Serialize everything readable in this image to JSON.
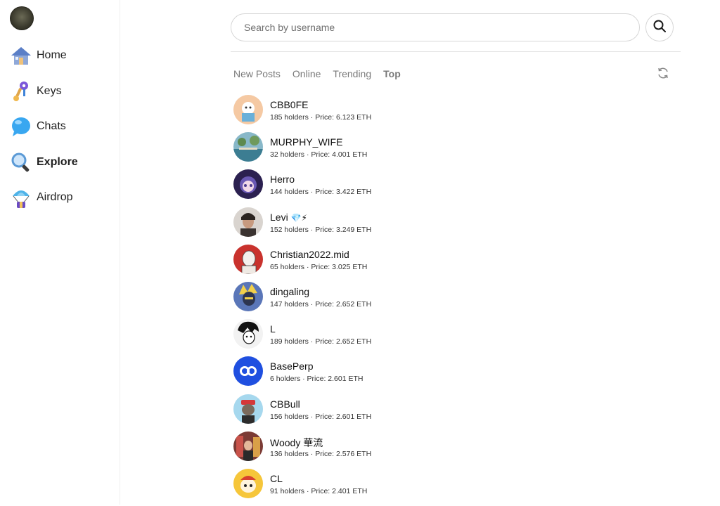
{
  "sidebar": {
    "items": [
      {
        "label": "Home",
        "icon": "house-icon"
      },
      {
        "label": "Keys",
        "icon": "key-icon"
      },
      {
        "label": "Chats",
        "icon": "chat-bubble-icon"
      },
      {
        "label": "Explore",
        "icon": "magnifier-icon",
        "active": true
      },
      {
        "label": "Airdrop",
        "icon": "parachute-icon"
      }
    ]
  },
  "search": {
    "placeholder": "Search by username",
    "value": ""
  },
  "tabs": [
    {
      "label": "New Posts"
    },
    {
      "label": "Online"
    },
    {
      "label": "Trending"
    },
    {
      "label": "Top",
      "active": true
    }
  ],
  "users": [
    {
      "name": "CBB0FE",
      "meta": "185 holders · Price: 6.123 ETH",
      "color": "#f2c39a"
    },
    {
      "name": "MURPHY_WIFE",
      "meta": "32 holders · Price: 4.001 ETH",
      "color": "#6e9bb0"
    },
    {
      "name": "Herro",
      "meta": "144 holders · Price: 3.422 ETH",
      "color": "#3f2f6e"
    },
    {
      "name": "Levi",
      "badge": "💎⚡",
      "meta": "152 holders · Price: 3.249 ETH",
      "color": "#5a4a40"
    },
    {
      "name": "Christian2022.mid",
      "meta": "65 holders · Price: 3.025 ETH",
      "color": "#c9322d"
    },
    {
      "name": "dingaling",
      "meta": "147 holders · Price: 2.652 ETH",
      "color": "#3a4d80"
    },
    {
      "name": "L",
      "meta": "189 holders · Price: 2.652 ETH",
      "color": "#ececec"
    },
    {
      "name": "BasePerp",
      "meta": "6 holders · Price: 2.601 ETH",
      "color": "#1f4fe0"
    },
    {
      "name": "CBBull",
      "meta": "156 holders · Price: 2.601 ETH",
      "color": "#a6d8ee"
    },
    {
      "name": "Woody 華流",
      "meta": "136 holders · Price: 2.576 ETH",
      "color": "#b0483f"
    },
    {
      "name": "CL",
      "meta": "91 holders · Price: 2.401 ETH",
      "color": "#f6c63a"
    }
  ]
}
